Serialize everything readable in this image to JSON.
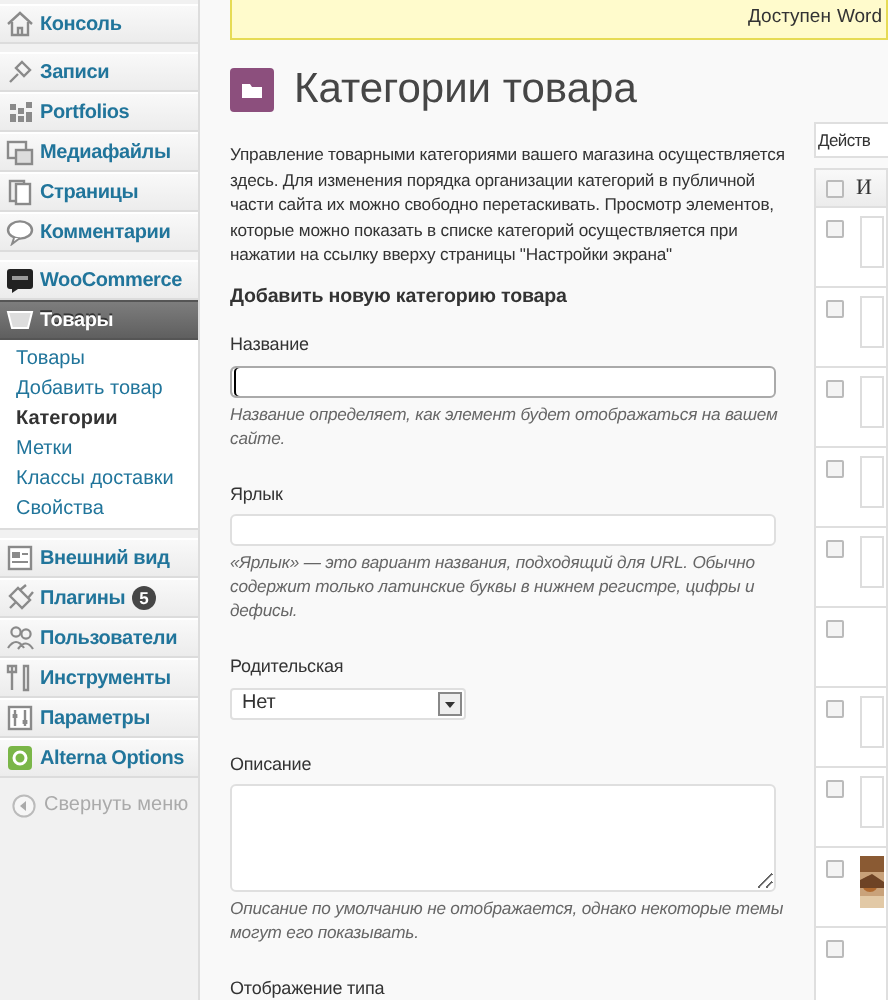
{
  "sidebar": {
    "items": [
      {
        "label": "Консоль",
        "selected": false,
        "group_end": true
      },
      {
        "label": "Записи",
        "selected": false
      },
      {
        "label": "Portfolios",
        "selected": false
      },
      {
        "label": "Медиафайлы",
        "selected": false
      },
      {
        "label": "Страницы",
        "selected": false
      },
      {
        "label": "Комментарии",
        "selected": false,
        "group_end": true
      },
      {
        "label": "WooCommerce",
        "selected": false
      },
      {
        "label": "Товары",
        "selected": true,
        "expanded": true,
        "group_end": true,
        "children": [
          {
            "label": "Товары",
            "selected": false
          },
          {
            "label": "Добавить товар",
            "selected": false
          },
          {
            "label": "Категории",
            "selected": true
          },
          {
            "label": "Метки",
            "selected": false
          },
          {
            "label": "Классы доставки",
            "selected": false
          },
          {
            "label": "Свойства",
            "selected": false
          }
        ]
      },
      {
        "label": "Внешний вид",
        "selected": false
      },
      {
        "label": "Плагины",
        "selected": false,
        "badge": "5"
      },
      {
        "label": "Пользователи",
        "selected": false
      },
      {
        "label": "Инструменты",
        "selected": false
      },
      {
        "label": "Параметры",
        "selected": false
      },
      {
        "label": "Alterna Options",
        "selected": false
      }
    ],
    "collapse": "Свернуть меню"
  },
  "notice": {
    "text": "Доступен",
    "link": "Word"
  },
  "page_title": "Категории товара",
  "description": "Управление товарными категориями вашего магазина осуществляется здесь. Для изменения порядка организации категорий в публичной части сайта их можно свободно перетаскивать. Просмотр элементов, которые можно показать в списке категорий осуществляется при нажатии на ссылку вверху страницы \"Настройки экрана\"",
  "form": {
    "title": "Добавить новую категорию товара",
    "fields": [
      {
        "kind": "text",
        "label": "Название",
        "focused": true,
        "hint": "Название определяет, как элемент будет отображаться на вашем сайте."
      },
      {
        "kind": "text",
        "label": "Ярлык",
        "focused": false,
        "hint": "«Ярлык» — это вариант названия, подходящий для URL. Обычно содержит только латинские буквы в нижнем регистре, цифры и дефисы."
      },
      {
        "kind": "select",
        "label": "Родительская",
        "value": "Нет"
      },
      {
        "kind": "textarea",
        "label": "Описание",
        "hint": "Описание по умолчанию не отображается, однако некоторые темы могут его показывать."
      },
      {
        "kind": "heading",
        "label": "Отображение типа"
      }
    ]
  },
  "table": {
    "bulk_action": "Действ",
    "column_1": "И",
    "header_checked": false,
    "rows": [
      {
        "checked": false,
        "kind": "empty"
      },
      {
        "checked": false,
        "kind": "empty"
      },
      {
        "checked": false,
        "kind": "empty"
      },
      {
        "checked": false,
        "kind": "empty"
      },
      {
        "checked": false,
        "kind": "empty"
      },
      {
        "checked": false,
        "kind": "none"
      },
      {
        "checked": false,
        "kind": "empty"
      },
      {
        "checked": false,
        "kind": "empty"
      },
      {
        "checked": false,
        "kind": "picture"
      },
      {
        "checked": false,
        "kind": "none"
      }
    ]
  }
}
